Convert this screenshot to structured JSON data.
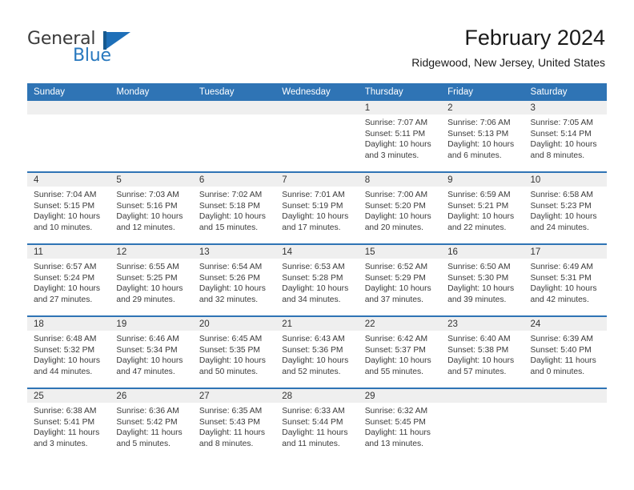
{
  "brand": {
    "word_one": "General",
    "word_two": "Blue",
    "mark": "triangle-flag-icon",
    "accent_dark": "#16598f",
    "accent": "#1e6fb8"
  },
  "header": {
    "title": "February 2024",
    "subtitle": "Ridgewood, New Jersey, United States"
  },
  "theme": {
    "header_blue": "#2f74b5",
    "daynum_band": "#efefef",
    "text": "#3a3a3a"
  },
  "calendar": {
    "weekday_headers": [
      "Sunday",
      "Monday",
      "Tuesday",
      "Wednesday",
      "Thursday",
      "Friday",
      "Saturday"
    ],
    "weeks": [
      [
        {
          "day": ""
        },
        {
          "day": ""
        },
        {
          "day": ""
        },
        {
          "day": ""
        },
        {
          "day": "1",
          "sunrise": "Sunrise: 7:07 AM",
          "sunset": "Sunset: 5:11 PM",
          "daylight_l1": "Daylight: 10 hours",
          "daylight_l2": "and 3 minutes."
        },
        {
          "day": "2",
          "sunrise": "Sunrise: 7:06 AM",
          "sunset": "Sunset: 5:13 PM",
          "daylight_l1": "Daylight: 10 hours",
          "daylight_l2": "and 6 minutes."
        },
        {
          "day": "3",
          "sunrise": "Sunrise: 7:05 AM",
          "sunset": "Sunset: 5:14 PM",
          "daylight_l1": "Daylight: 10 hours",
          "daylight_l2": "and 8 minutes."
        }
      ],
      [
        {
          "day": "4",
          "sunrise": "Sunrise: 7:04 AM",
          "sunset": "Sunset: 5:15 PM",
          "daylight_l1": "Daylight: 10 hours",
          "daylight_l2": "and 10 minutes."
        },
        {
          "day": "5",
          "sunrise": "Sunrise: 7:03 AM",
          "sunset": "Sunset: 5:16 PM",
          "daylight_l1": "Daylight: 10 hours",
          "daylight_l2": "and 12 minutes."
        },
        {
          "day": "6",
          "sunrise": "Sunrise: 7:02 AM",
          "sunset": "Sunset: 5:18 PM",
          "daylight_l1": "Daylight: 10 hours",
          "daylight_l2": "and 15 minutes."
        },
        {
          "day": "7",
          "sunrise": "Sunrise: 7:01 AM",
          "sunset": "Sunset: 5:19 PM",
          "daylight_l1": "Daylight: 10 hours",
          "daylight_l2": "and 17 minutes."
        },
        {
          "day": "8",
          "sunrise": "Sunrise: 7:00 AM",
          "sunset": "Sunset: 5:20 PM",
          "daylight_l1": "Daylight: 10 hours",
          "daylight_l2": "and 20 minutes."
        },
        {
          "day": "9",
          "sunrise": "Sunrise: 6:59 AM",
          "sunset": "Sunset: 5:21 PM",
          "daylight_l1": "Daylight: 10 hours",
          "daylight_l2": "and 22 minutes."
        },
        {
          "day": "10",
          "sunrise": "Sunrise: 6:58 AM",
          "sunset": "Sunset: 5:23 PM",
          "daylight_l1": "Daylight: 10 hours",
          "daylight_l2": "and 24 minutes."
        }
      ],
      [
        {
          "day": "11",
          "sunrise": "Sunrise: 6:57 AM",
          "sunset": "Sunset: 5:24 PM",
          "daylight_l1": "Daylight: 10 hours",
          "daylight_l2": "and 27 minutes."
        },
        {
          "day": "12",
          "sunrise": "Sunrise: 6:55 AM",
          "sunset": "Sunset: 5:25 PM",
          "daylight_l1": "Daylight: 10 hours",
          "daylight_l2": "and 29 minutes."
        },
        {
          "day": "13",
          "sunrise": "Sunrise: 6:54 AM",
          "sunset": "Sunset: 5:26 PM",
          "daylight_l1": "Daylight: 10 hours",
          "daylight_l2": "and 32 minutes."
        },
        {
          "day": "14",
          "sunrise": "Sunrise: 6:53 AM",
          "sunset": "Sunset: 5:28 PM",
          "daylight_l1": "Daylight: 10 hours",
          "daylight_l2": "and 34 minutes."
        },
        {
          "day": "15",
          "sunrise": "Sunrise: 6:52 AM",
          "sunset": "Sunset: 5:29 PM",
          "daylight_l1": "Daylight: 10 hours",
          "daylight_l2": "and 37 minutes."
        },
        {
          "day": "16",
          "sunrise": "Sunrise: 6:50 AM",
          "sunset": "Sunset: 5:30 PM",
          "daylight_l1": "Daylight: 10 hours",
          "daylight_l2": "and 39 minutes."
        },
        {
          "day": "17",
          "sunrise": "Sunrise: 6:49 AM",
          "sunset": "Sunset: 5:31 PM",
          "daylight_l1": "Daylight: 10 hours",
          "daylight_l2": "and 42 minutes."
        }
      ],
      [
        {
          "day": "18",
          "sunrise": "Sunrise: 6:48 AM",
          "sunset": "Sunset: 5:32 PM",
          "daylight_l1": "Daylight: 10 hours",
          "daylight_l2": "and 44 minutes."
        },
        {
          "day": "19",
          "sunrise": "Sunrise: 6:46 AM",
          "sunset": "Sunset: 5:34 PM",
          "daylight_l1": "Daylight: 10 hours",
          "daylight_l2": "and 47 minutes."
        },
        {
          "day": "20",
          "sunrise": "Sunrise: 6:45 AM",
          "sunset": "Sunset: 5:35 PM",
          "daylight_l1": "Daylight: 10 hours",
          "daylight_l2": "and 50 minutes."
        },
        {
          "day": "21",
          "sunrise": "Sunrise: 6:43 AM",
          "sunset": "Sunset: 5:36 PM",
          "daylight_l1": "Daylight: 10 hours",
          "daylight_l2": "and 52 minutes."
        },
        {
          "day": "22",
          "sunrise": "Sunrise: 6:42 AM",
          "sunset": "Sunset: 5:37 PM",
          "daylight_l1": "Daylight: 10 hours",
          "daylight_l2": "and 55 minutes."
        },
        {
          "day": "23",
          "sunrise": "Sunrise: 6:40 AM",
          "sunset": "Sunset: 5:38 PM",
          "daylight_l1": "Daylight: 10 hours",
          "daylight_l2": "and 57 minutes."
        },
        {
          "day": "24",
          "sunrise": "Sunrise: 6:39 AM",
          "sunset": "Sunset: 5:40 PM",
          "daylight_l1": "Daylight: 11 hours",
          "daylight_l2": "and 0 minutes."
        }
      ],
      [
        {
          "day": "25",
          "sunrise": "Sunrise: 6:38 AM",
          "sunset": "Sunset: 5:41 PM",
          "daylight_l1": "Daylight: 11 hours",
          "daylight_l2": "and 3 minutes."
        },
        {
          "day": "26",
          "sunrise": "Sunrise: 6:36 AM",
          "sunset": "Sunset: 5:42 PM",
          "daylight_l1": "Daylight: 11 hours",
          "daylight_l2": "and 5 minutes."
        },
        {
          "day": "27",
          "sunrise": "Sunrise: 6:35 AM",
          "sunset": "Sunset: 5:43 PM",
          "daylight_l1": "Daylight: 11 hours",
          "daylight_l2": "and 8 minutes."
        },
        {
          "day": "28",
          "sunrise": "Sunrise: 6:33 AM",
          "sunset": "Sunset: 5:44 PM",
          "daylight_l1": "Daylight: 11 hours",
          "daylight_l2": "and 11 minutes."
        },
        {
          "day": "29",
          "sunrise": "Sunrise: 6:32 AM",
          "sunset": "Sunset: 5:45 PM",
          "daylight_l1": "Daylight: 11 hours",
          "daylight_l2": "and 13 minutes."
        },
        {
          "day": ""
        },
        {
          "day": ""
        }
      ]
    ]
  }
}
